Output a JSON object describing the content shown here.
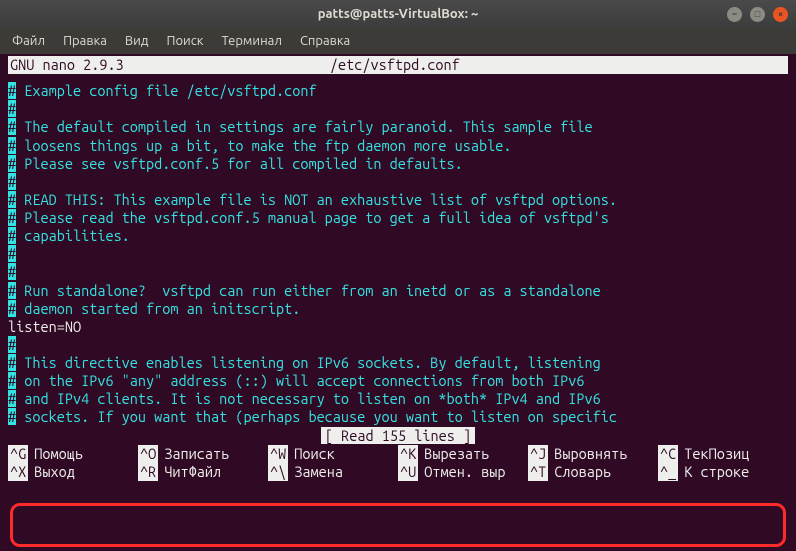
{
  "titlebar": {
    "title": "patts@patts-VirtualBox: ~"
  },
  "menubar": {
    "items": [
      "Файл",
      "Правка",
      "Вид",
      "Поиск",
      "Терминал",
      "Справка"
    ]
  },
  "nano": {
    "header_left": "  GNU nano 2.9.3",
    "header_center": "/etc/vsftpd.conf",
    "status": "[ Read 155 lines ]",
    "lines": [
      {
        "t": "hc",
        "h": "#",
        "c": " Example config file /etc/vsftpd.conf"
      },
      {
        "t": "hc",
        "h": "#",
        "c": ""
      },
      {
        "t": "hc",
        "h": "#",
        "c": " The default compiled in settings are fairly paranoid. This sample file"
      },
      {
        "t": "hc",
        "h": "#",
        "c": " loosens things up a bit, to make the ftp daemon more usable."
      },
      {
        "t": "hc",
        "h": "#",
        "c": " Please see vsftpd.conf.5 for all compiled in defaults."
      },
      {
        "t": "hc",
        "h": "#",
        "c": ""
      },
      {
        "t": "hc",
        "h": "#",
        "c": " READ THIS: This example file is NOT an exhaustive list of vsftpd options."
      },
      {
        "t": "hc",
        "h": "#",
        "c": " Please read the vsftpd.conf.5 manual page to get a full idea of vsftpd's"
      },
      {
        "t": "hc",
        "h": "#",
        "c": " capabilities."
      },
      {
        "t": "hc",
        "h": "#",
        "c": ""
      },
      {
        "t": "hc",
        "h": "#",
        "c": ""
      },
      {
        "t": "hc",
        "h": "#",
        "c": " Run standalone?  vsftpd can run either from an inetd or as a standalone"
      },
      {
        "t": "hc",
        "h": "#",
        "c": " daemon started from an initscript."
      },
      {
        "t": "p",
        "c": "listen=NO"
      },
      {
        "t": "hc",
        "h": "#",
        "c": ""
      },
      {
        "t": "hc",
        "h": "#",
        "c": " This directive enables listening on IPv6 sockets. By default, listening"
      },
      {
        "t": "hc",
        "h": "#",
        "c": " on the IPv6 \"any\" address (::) will accept connections from both IPv6"
      },
      {
        "t": "hc",
        "h": "#",
        "c": " and IPv4 clients. It is not necessary to listen on *both* IPv4 and IPv6"
      },
      {
        "t": "hc",
        "h": "#",
        "c": " sockets. If you want that (perhaps because you want to listen on specific"
      }
    ],
    "shortcuts_row1": [
      {
        "key": "^G",
        "label": "Помощь"
      },
      {
        "key": "^O",
        "label": "Записать"
      },
      {
        "key": "^W",
        "label": "Поиск"
      },
      {
        "key": "^K",
        "label": "Вырезать"
      },
      {
        "key": "^J",
        "label": "Выровнять"
      },
      {
        "key": "^C",
        "label": "ТекПозиц"
      }
    ],
    "shortcuts_row2": [
      {
        "key": "^X",
        "label": "Выход"
      },
      {
        "key": "^R",
        "label": "ЧитФайл"
      },
      {
        "key": "^\\",
        "label": "Замена"
      },
      {
        "key": "^U",
        "label": "Отмен. выр"
      },
      {
        "key": "^T",
        "label": "Словарь"
      },
      {
        "key": "^_",
        "label": "К строке"
      }
    ]
  }
}
